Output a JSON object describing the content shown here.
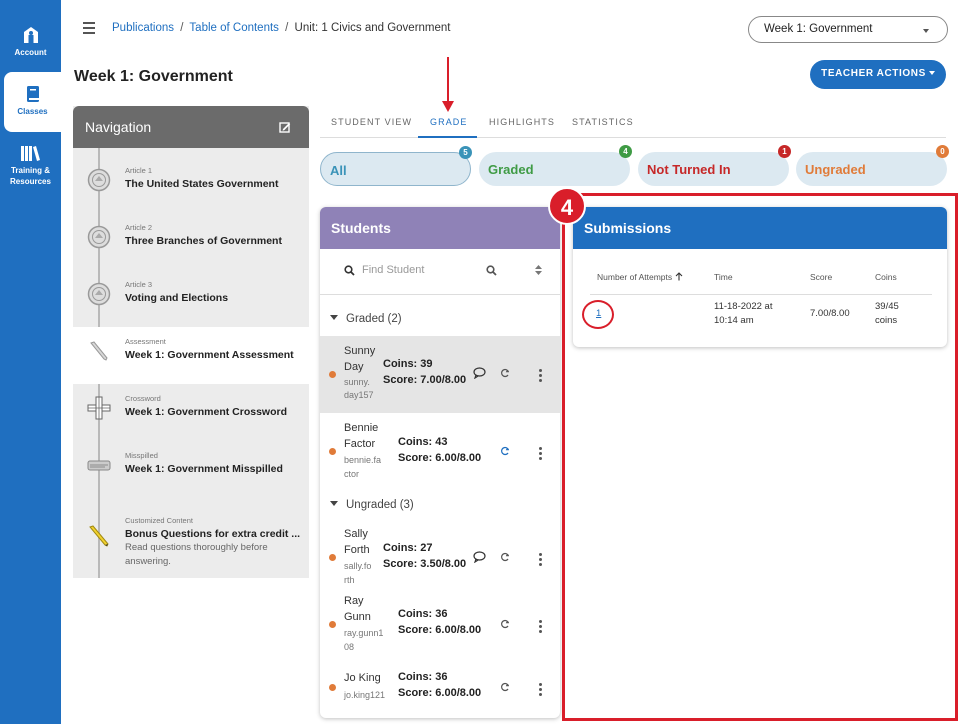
{
  "rail": {
    "account": "Account",
    "classes": "Classes",
    "training_l1": "Training &",
    "training_l2": "Resources"
  },
  "breadcrumb": {
    "publications": "Publications",
    "sep": "/",
    "toc": "Table of Contents",
    "current": "Unit: 1 Civics and Government"
  },
  "week_select": {
    "value": "Week 1: Government"
  },
  "page_title": "Week 1: Government",
  "teacher_actions": "TEACHER ACTIONS",
  "navigation": {
    "title": "Navigation",
    "items": [
      {
        "category": "Article 1",
        "title": "The United States Government"
      },
      {
        "category": "Article 2",
        "title": "Three Branches of Government"
      },
      {
        "category": "Article 3",
        "title": "Voting and Elections"
      },
      {
        "category": "Assessment",
        "title": "Week 1: Government Assessment"
      },
      {
        "category": "Crossword",
        "title": "Week 1: Government Crossword"
      },
      {
        "category": "Misspilled",
        "title": "Week 1: Government Misspilled"
      },
      {
        "category": "Customized Content",
        "title": "Bonus Questions for extra credit ...",
        "desc": "Read questions thoroughly before answering."
      }
    ]
  },
  "tabs": [
    "STUDENT VIEW",
    "GRADE",
    "HIGHLIGHTS",
    "STATISTICS"
  ],
  "filters": [
    {
      "label": "All",
      "count": "5",
      "color": "#3a93b8",
      "badge": "#3a93b8"
    },
    {
      "label": "Graded",
      "count": "4",
      "color": "#3f9b45",
      "badge": "#3f9b45"
    },
    {
      "label": "Not Turned In",
      "count": "1",
      "color": "#c62828",
      "badge": "#c62828"
    },
    {
      "label": "Ungraded",
      "count": "0",
      "color": "#e07b39",
      "badge": "#e07b39"
    }
  ],
  "students": {
    "title": "Students",
    "search_placeholder": "Find Student",
    "graded_group": "Graded (2)",
    "ungraded_group": "Ungraded (3)",
    "rows": [
      {
        "name1": "Sunny",
        "name2": "Day",
        "user1": "sunny.",
        "user2": "day157",
        "coins": "Coins: 39",
        "score": "Score: 7.00/8.00"
      },
      {
        "name1": "Bennie",
        "name2": "Factor",
        "user1": "bennie.fa",
        "user2": "ctor",
        "coins": "Coins: 43",
        "score": "Score: 6.00/8.00"
      },
      {
        "name1": "Sally",
        "name2": "Forth",
        "user1": "sally.fo",
        "user2": "rth",
        "coins": "Coins: 27",
        "score": "Score: 3.50/8.00"
      },
      {
        "name1": "Ray",
        "name2": "Gunn",
        "user1": "ray.gunn1",
        "user2": "08",
        "coins": "Coins: 36",
        "score": "Score: 6.00/8.00"
      },
      {
        "name1": "Jo King",
        "name2": "",
        "user1": "jo.king121",
        "user2": "",
        "coins": "Coins: 36",
        "score": "Score: 6.00/8.00"
      }
    ]
  },
  "submissions": {
    "title": "Submissions",
    "headers": {
      "attempts": "Number of Attempts",
      "time": "Time",
      "score": "Score",
      "coins": "Coins"
    },
    "row": {
      "attempt": "1",
      "time1": "11-18-2022 at",
      "time2": "10:14 am",
      "score": "7.00/8.00",
      "coins1": "39/45",
      "coins2": "coins"
    }
  },
  "annotation": {
    "step": "4"
  }
}
